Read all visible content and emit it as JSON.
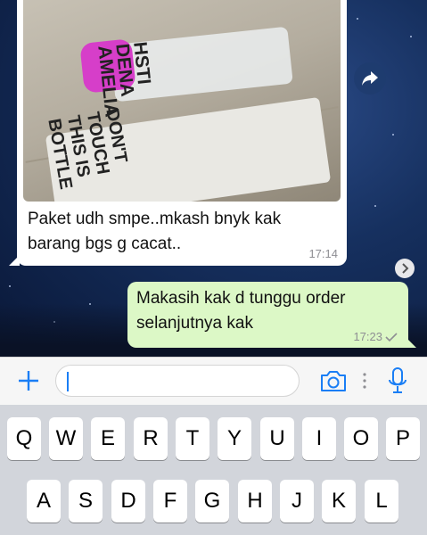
{
  "incoming_message": {
    "text_line1": "Paket udh smpe..mkash bnyk kak",
    "text_line2": "barang bgs g cacat..",
    "time": "17:14",
    "photo": {
      "bottle_text_lines": [
        "HSTI",
        "DENA",
        "AMELIA"
      ],
      "pouch_text_lines": [
        "DON'T",
        "TOUCH",
        "THIS IS",
        "BOTTLE"
      ]
    }
  },
  "outgoing_message": {
    "text_line1": "Makasih kak d tunggu order",
    "text_line2": "selanjutnya kak",
    "time": "17:23"
  },
  "input_bar": {
    "text_value": "",
    "icons": [
      "plus-icon",
      "camera-icon",
      "more-dots-icon",
      "microphone-icon"
    ]
  },
  "keyboard": {
    "row1": [
      "Q",
      "W",
      "E",
      "R",
      "T",
      "Y",
      "U",
      "I",
      "O",
      "P"
    ],
    "row2": [
      "A",
      "S",
      "D",
      "F",
      "G",
      "H",
      "J",
      "K",
      "L"
    ]
  },
  "colors": {
    "accent": "#1a7ef5",
    "outgoing_bubble": "#dcf8c6",
    "incoming_bubble": "#ffffff"
  }
}
